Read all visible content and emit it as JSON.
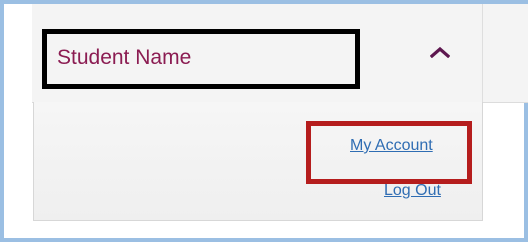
{
  "header": {
    "user_name": "Student Name",
    "caret_icon": "chevron-up-icon"
  },
  "menu": {
    "my_account_label": "My Account",
    "logout_label": "Log Out"
  },
  "colors": {
    "frame_border": "#9bbfe3",
    "name_text": "#8b1c52",
    "link_text": "#2f6db3",
    "highlight_black": "#000000",
    "highlight_red": "#b51d1d"
  }
}
